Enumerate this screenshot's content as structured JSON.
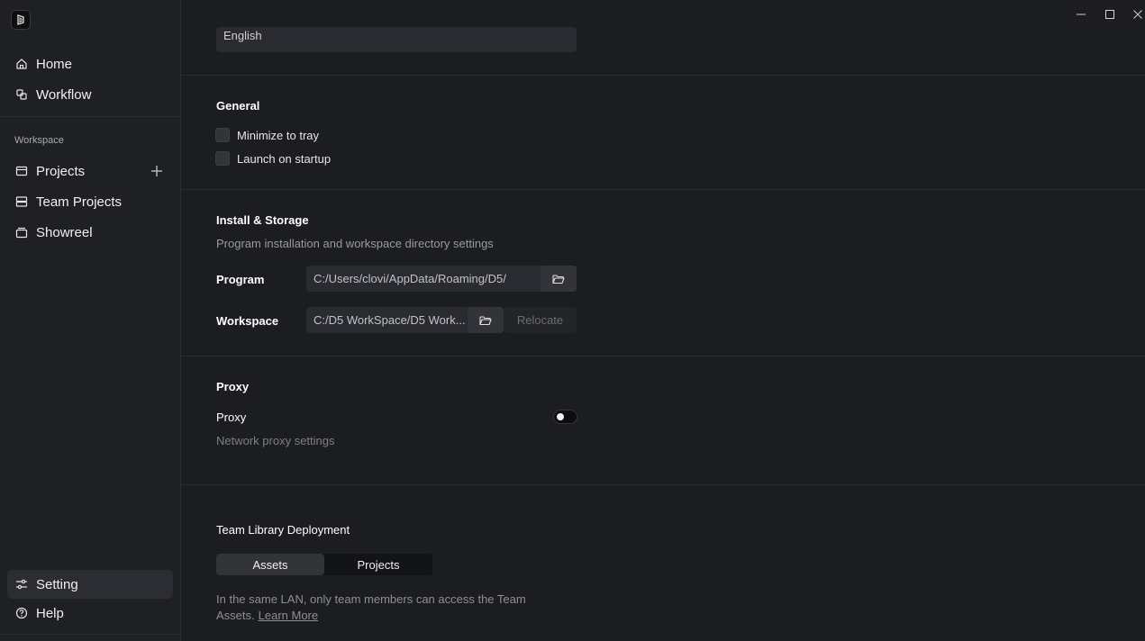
{
  "sidebar": {
    "top_items": [
      {
        "label": "Home",
        "icon": "home-icon"
      },
      {
        "label": "Workflow",
        "icon": "workflow-icon"
      }
    ],
    "section_label": "Workspace",
    "workspace_items": [
      {
        "label": "Projects",
        "icon": "projects-icon"
      },
      {
        "label": "Team Projects",
        "icon": "team-projects-icon"
      },
      {
        "label": "Showreel",
        "icon": "showreel-icon"
      }
    ],
    "bottom_items": [
      {
        "label": "Setting",
        "icon": "sliders-icon",
        "active": true
      },
      {
        "label": "Help",
        "icon": "help-icon"
      }
    ]
  },
  "language": {
    "value": "English"
  },
  "general": {
    "title": "General",
    "minimize_to_tray": {
      "label": "Minimize to tray",
      "checked": false
    },
    "launch_on_startup": {
      "label": "Launch on startup",
      "checked": false
    }
  },
  "install_storage": {
    "title": "Install & Storage",
    "description": "Program installation and workspace directory settings",
    "program_label": "Program",
    "program_path": "C:/Users/clovi/AppData/Roaming/D5/",
    "workspace_label": "Workspace",
    "workspace_path": "C:/D5 WorkSpace/D5 Work...",
    "relocate_label": "Relocate"
  },
  "proxy": {
    "title": "Proxy",
    "label": "Proxy",
    "enabled": false,
    "description": "Network proxy settings"
  },
  "team_library": {
    "title": "Team Library Deployment",
    "tabs": [
      "Assets",
      "Projects"
    ],
    "active_tab": "Assets",
    "description": "In the same LAN, only team members can access the Team Assets.",
    "learn_more": "Learn More"
  },
  "colors": {
    "background": "#1c1d21",
    "sidebar": "#1f2024",
    "active_item": "#2c2d32"
  }
}
